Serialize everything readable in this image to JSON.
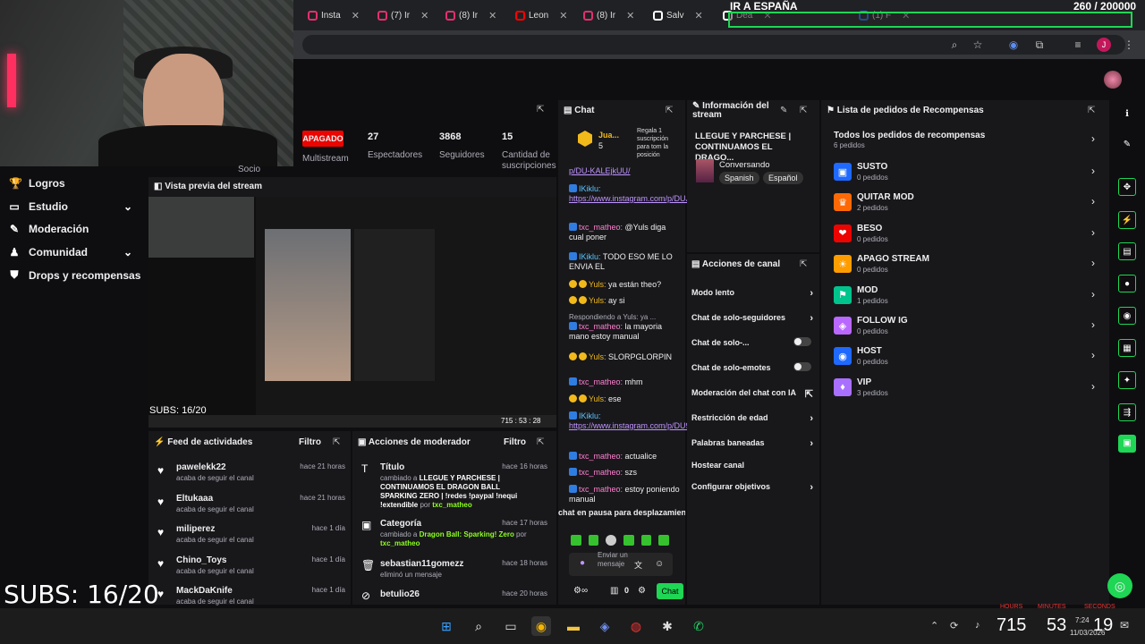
{
  "overlay": {
    "stream_title": "IR A ESPAÑA",
    "sub_goal": "260  / 200000",
    "subs_small": "SUBS: 16/20",
    "subs_big": "SUBS: 16/20",
    "cam_label": "Socio"
  },
  "tabs": [
    {
      "label": "Insta",
      "color": "#e1306c"
    },
    {
      "label": "(7) Ir",
      "color": "#e1306c"
    },
    {
      "label": "(8) Ir",
      "color": "#e1306c"
    },
    {
      "label": "Leon",
      "color": "#ff0000"
    },
    {
      "label": "(8) Ir",
      "color": "#e1306c"
    },
    {
      "label": "Salv",
      "color": "#ffffff"
    },
    {
      "label": "Dea",
      "color": "#ffffff"
    },
    {
      "label": "(1) F",
      "color": "#1877f2"
    }
  ],
  "nav": [
    {
      "label": "Logros",
      "icon": "trophy-icon",
      "chev": ""
    },
    {
      "label": "Estudio",
      "icon": "studio-icon",
      "chev": "⌄"
    },
    {
      "label": "Moderación",
      "icon": "wrench-icon",
      "chev": ""
    },
    {
      "label": "Comunidad",
      "icon": "community-icon",
      "chev": "⌄"
    },
    {
      "label": "Drops y recompensas",
      "icon": "drops-icon",
      "chev": ""
    }
  ],
  "stats": {
    "status": "APAGADO",
    "multistream_label": "Multistream",
    "viewers": "27",
    "viewers_label": "Espectadores",
    "followers": "3868",
    "followers_label": "Seguidores",
    "subs": "15",
    "subs_label": "Cantidad de suscripciones"
  },
  "preview": {
    "title": "Vista previa del stream"
  },
  "feed": {
    "title": "Feed de actividades",
    "filter": "Filtro",
    "items": [
      {
        "name": "pawelekk22",
        "action": "acaba de seguir el canal",
        "time": "hace 21 horas"
      },
      {
        "name": "Eltukaaa",
        "action": "acaba de seguir el canal",
        "time": "hace 21 horas"
      },
      {
        "name": "miliperez",
        "action": "acaba de seguir el canal",
        "time": "hace 1 día"
      },
      {
        "name": "Chino_Toys",
        "action": "acaba de seguir el canal",
        "time": "hace 1 día"
      },
      {
        "name": "MackDaKnife",
        "action": "acaba de seguir el canal",
        "time": "hace 1 día"
      }
    ]
  },
  "modactions": {
    "title": "Acciones de moderador",
    "filter": "Filtro",
    "items": [
      {
        "name": "Título",
        "time": "hace 16 horas",
        "pre": "cambiado a ",
        "bold": "LLEGUE Y PARCHESE | CONTINUAMOS EL DRAGON BALL SPARKING ZERO | !redes !paypal !nequi !extendible",
        "by": " por ",
        "user": "txc_matheo"
      },
      {
        "name": "Categoría",
        "time": "hace 17 horas",
        "pre": "cambiado a ",
        "bold": "Dragon Ball: Sparking! Zero",
        "by": " por ",
        "user": "txc_matheo"
      },
      {
        "name": "sebastian11gomezz",
        "time": "hace 18 horas",
        "pre": "eliminó un mensaje",
        "bold": "",
        "by": "",
        "user": ""
      },
      {
        "name": "betulio26",
        "time": "hace 20 horas",
        "pre": "",
        "bold": "",
        "by": "",
        "user": ""
      }
    ]
  },
  "chat": {
    "title": "Chat",
    "gift_user": "Jua...",
    "gift_count": "5",
    "gift_text": "Regala 1 suscripción para tom la posición",
    "paused": "chat en pausa para desplazamiento",
    "input_placeholder": "Enviar un mensaje",
    "send_label": "Chat",
    "points": "0",
    "messages": [
      {
        "user": "",
        "text": "p/DU-KALEjkUU/",
        "link": true
      },
      {
        "user": "IKiklu:",
        "text": "https://www.instagram.com/p/DUJK_7SEcaY/",
        "link": true
      },
      {
        "user": "txc_matheo:",
        "text": "@Yuls diga cual poner",
        "link": false
      },
      {
        "user": "IKiklu:",
        "text": "TODO ESO ME LO ENVIA EL",
        "link": false
      },
      {
        "user": "Yuls:",
        "text": "ya están theo?",
        "link": false
      },
      {
        "user": "Yuls:",
        "text": "ay si",
        "link": false
      },
      {
        "user": "",
        "text": "Respondiendo a Yuls: ya ...",
        "link": false
      },
      {
        "user": "txc_matheo:",
        "text": "la mayoria mano estoy manual",
        "link": false
      },
      {
        "user": "Yuls:",
        "text": "SLORPGLORPIN",
        "link": false
      },
      {
        "user": "txc_matheo:",
        "text": "mhm",
        "link": false
      },
      {
        "user": "Yuls:",
        "text": "ese",
        "link": false
      },
      {
        "user": "IKiklu:",
        "text": "https://www.instagram.com/p/DU9p85DAG0B/",
        "link": true
      },
      {
        "user": "txc_matheo:",
        "text": "actualice",
        "link": false
      },
      {
        "user": "txc_matheo:",
        "text": "szs",
        "link": false
      },
      {
        "user": "txc_matheo:",
        "text": "estoy poniendo manual",
        "link": false
      }
    ]
  },
  "info": {
    "title": "Información del stream",
    "stream_title": "LLEGUE Y PARCHESE | CONTINUAMOS EL DRAGO...",
    "category": "Conversando",
    "tags": [
      "Spanish",
      "Español"
    ]
  },
  "channel_actions": {
    "title": "Acciones de canal",
    "items": [
      {
        "label": "Modo lento",
        "kind": "chevron"
      },
      {
        "label": "Chat de solo-seguidores",
        "kind": "chevron"
      },
      {
        "label": "Chat de solo-...",
        "kind": "toggle"
      },
      {
        "label": "Chat de solo-emotes",
        "kind": "toggle"
      },
      {
        "label": "Moderación del chat con IA",
        "kind": "external"
      },
      {
        "label": "Restricción de edad",
        "kind": "chevron"
      },
      {
        "label": "Palabras baneadas",
        "kind": "chevron"
      },
      {
        "label": "Hostear canal",
        "kind": "none"
      },
      {
        "label": "Configurar objetivos",
        "kind": "chevron"
      }
    ]
  },
  "rewards": {
    "title": "Lista de pedidos de Recompensas",
    "all_label": "Todos los pedidos de recompensas",
    "all_count": "6 pedidos",
    "items": [
      {
        "name": "SUSTO",
        "count": "0 pedidos",
        "color": "#1f69ff"
      },
      {
        "name": "QUITAR MOD",
        "count": "2 pedidos",
        "color": "#ff6905"
      },
      {
        "name": "BESO",
        "count": "0 pedidos",
        "color": "#eb0400"
      },
      {
        "name": "APAGO STREAM",
        "count": "0 pedidos",
        "color": "#ff9d00"
      },
      {
        "name": "MOD",
        "count": "1 pedidos",
        "color": "#00c48c"
      },
      {
        "name": "FOLLOW IG",
        "count": "0 pedidos",
        "color": "#b968ff"
      },
      {
        "name": "HOST",
        "count": "0 pedidos",
        "color": "#1f69ff"
      },
      {
        "name": "VIP",
        "count": "3 pedidos",
        "color": "#a970ff"
      }
    ]
  },
  "clock": {
    "big1": "715",
    "big2": "53",
    "big3": "19",
    "time": "7:24",
    "date": "11/03/2026",
    "lbl1": "HOURS",
    "lbl2": "MINUTES",
    "lbl3": "SECONDS"
  },
  "preview_overlay": {
    "counter": "715 : 53 : 28"
  }
}
